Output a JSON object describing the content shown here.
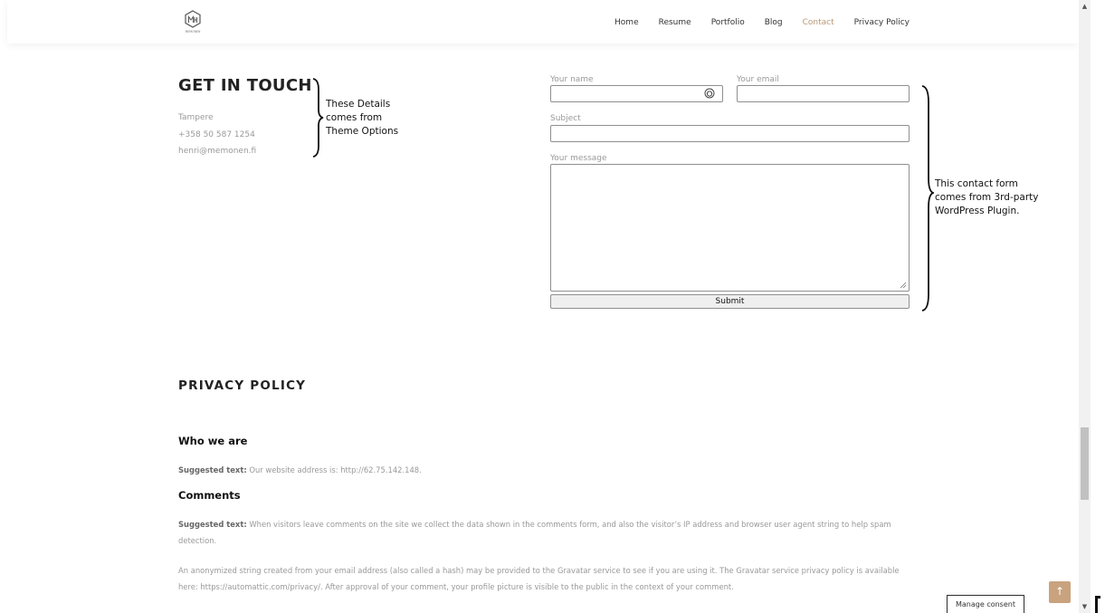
{
  "header": {
    "logo_text": "MEMONEN",
    "nav": [
      {
        "label": "Home",
        "active": false
      },
      {
        "label": "Resume",
        "active": false
      },
      {
        "label": "Portfolio",
        "active": false
      },
      {
        "label": "Blog",
        "active": false
      },
      {
        "label": "Contact",
        "active": true
      },
      {
        "label": "Privacy Policy",
        "active": false
      }
    ]
  },
  "contact": {
    "title": "GET IN TOUCH",
    "city": "Tampere",
    "phone": "+358 50 587 1254",
    "email": "henri@memonen.fi",
    "theme_note": [
      "These Details",
      "comes from",
      "Theme Options"
    ],
    "plugin_note": [
      "This contact form",
      "comes from 3rd-party",
      "WordPress Plugin."
    ]
  },
  "form": {
    "name_label": "Your name",
    "name_value": "",
    "email_label": "Your email",
    "email_value": "",
    "subject_label": "Subject",
    "subject_value": "",
    "message_label": "Your message",
    "message_value": "",
    "submit_label": "Submit"
  },
  "privacy": {
    "title": "PRIVACY POLICY",
    "who_heading": "Who we are",
    "who_prefix": "Suggested text:",
    "who_text": " Our website address is: http://62.75.142.148.",
    "comments_heading": "Comments",
    "comments_prefix": "Suggested text:",
    "comments_text": " When visitors leave comments on the site we collect the data shown in the comments form, and also the visitor’s IP address and browser user agent string to help spam detection.",
    "gravatar_text": "An anonymized string created from your email address (also called a hash) may be provided to the Gravatar service to see if you are using it. The Gravatar service privacy policy is available here: https://automattic.com/privacy/. After approval of your comment, your profile picture is visible to the public in the context of your comment."
  },
  "widgets": {
    "consent_label": "Manage consent",
    "to_top_icon": "arrow-up-icon",
    "accent_color": "#b89775",
    "to_top_color": "#c9a27e"
  }
}
